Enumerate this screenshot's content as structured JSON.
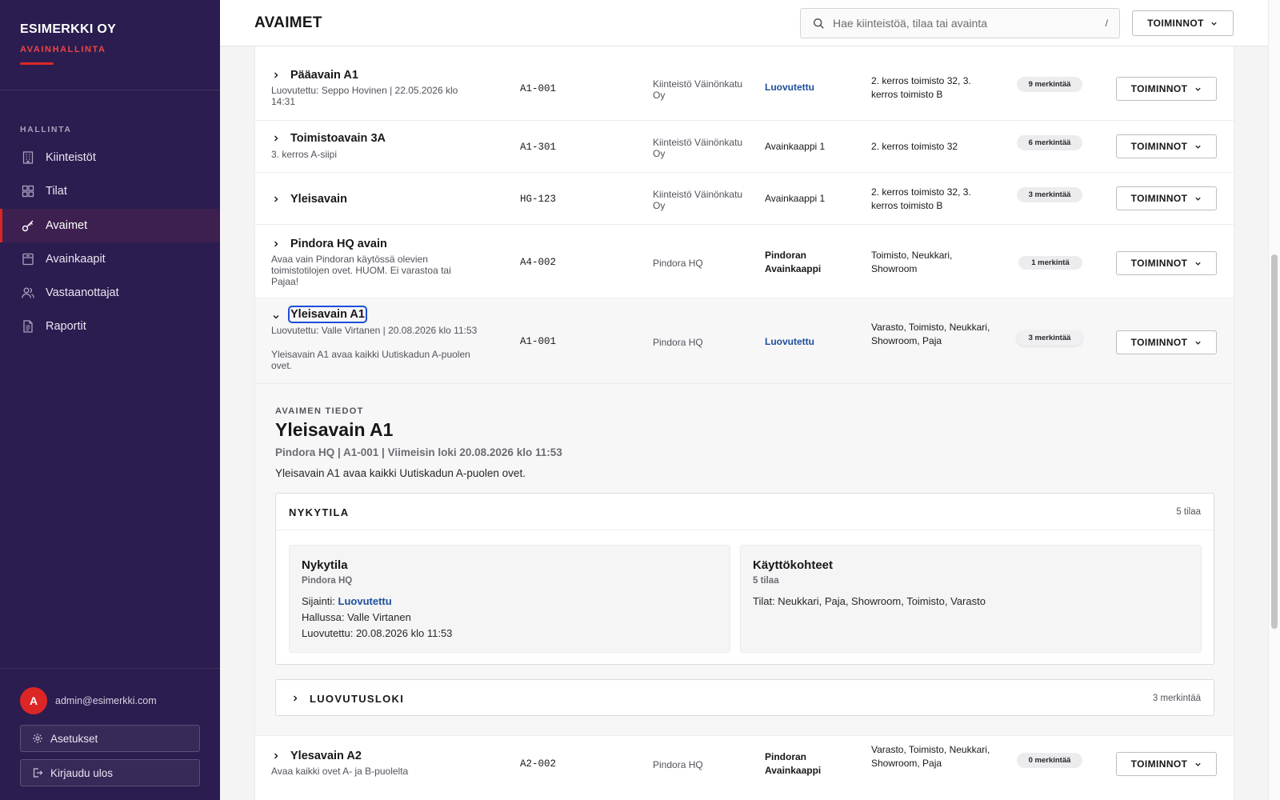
{
  "sidebar": {
    "brand": "ESIMERKKI OY",
    "subtitle": "AVAINHALLINTA",
    "section": "HALLINTA",
    "items": [
      {
        "label": "Kiinteistöt",
        "icon": "building-icon"
      },
      {
        "label": "Tilat",
        "icon": "grid-icon"
      },
      {
        "label": "Avaimet",
        "icon": "key-icon"
      },
      {
        "label": "Avainkaapit",
        "icon": "cabinet-icon"
      },
      {
        "label": "Vastaanottajat",
        "icon": "users-icon"
      },
      {
        "label": "Raportit",
        "icon": "report-icon"
      }
    ],
    "active_item": "Avaimet",
    "user_initial": "A",
    "user_email": "admin@esimerkki.com",
    "settings_label": "Asetukset",
    "logout_label": "Kirjaudu ulos"
  },
  "header": {
    "title": "AVAIMET",
    "search_placeholder": "Hae kiinteistöä, tilaa tai avainta",
    "search_shortcut": "/",
    "actions_label": "TOIMINNOT"
  },
  "keys": [
    {
      "name": "Pääavain A1",
      "sub": "Luovutettu: Seppo Hovinen | 22.05.2026 klo 14:31",
      "code": "A1-001",
      "property": "Kiinteistö Väinönkatu Oy",
      "location": "Luovutettu",
      "rooms": "2. kerros toimisto 32, 3. kerros toimisto B",
      "badge": "9 merkintää",
      "action": "TOIMINNOT"
    },
    {
      "name": "Toimistoavain 3A",
      "sub": "3. kerros A-siipi",
      "code": "A1-301",
      "property": "Kiinteistö Väinönkatu Oy",
      "location": "Avainkaappi 1",
      "rooms": "2. kerros toimisto 32",
      "badge": "6 merkintää",
      "action": "TOIMINNOT"
    },
    {
      "name": "Yleisavain",
      "sub": "",
      "code": "HG-123",
      "property": "Kiinteistö Väinönkatu Oy",
      "location": "Avainkaappi 1",
      "rooms": "2. kerros toimisto 32, 3. kerros toimisto B",
      "badge": "3 merkintää",
      "action": "TOIMINNOT"
    },
    {
      "name": "Pindora HQ avain",
      "sub": "Avaa vain Pindoran käytössä olevien toimistotilojen ovet. HUOM. Ei varastoa tai Pajaa!",
      "code": "A4-002",
      "property": "Pindora HQ",
      "location": "Pindoran Avainkaappi",
      "rooms": "Toimisto, Neukkari, Showroom",
      "badge": "1 merkintä",
      "action": "TOIMINNOT"
    },
    {
      "name": "Yleisavain A1",
      "sub": "Luovutettu: Valle Virtanen | 20.08.2026 klo 11:53",
      "sub2": "Yleisavain A1 avaa kaikki Uutiskadun A-puolen ovet.",
      "code": "A1-001",
      "property": "Pindora HQ",
      "location": "Luovutettu",
      "rooms": "Varasto, Toimisto, Neukkari, Showroom, Paja",
      "badge": "3 merkintää",
      "action": "TOIMINNOT"
    },
    {
      "name": "Ylesavain A2",
      "sub": "Avaa kaikki ovet A- ja B-puolelta",
      "code": "A2-002",
      "property": "Pindora HQ",
      "location": "Pindoran Avainkaappi",
      "rooms": "Varasto, Toimisto, Neukkari, Showroom, Paja",
      "badge": "0 merkintää",
      "action": "TOIMINNOT"
    }
  ],
  "details": {
    "label": "AVAIMEN TIEDOT",
    "title": "Yleisavain A1",
    "meta": "Pindora HQ | A1-001 | Viimeisin loki 20.08.2026 klo 11:53",
    "description": "Yleisavain A1 avaa kaikki Uutiskadun A-puolen ovet.",
    "current_section": {
      "title": "NYKYTILA",
      "count": "5 tilaa",
      "status_card": {
        "title": "Nykytila",
        "subtitle": "Pindora HQ",
        "location_label": "Sijainti: ",
        "location_value": "Luovutettu",
        "holder": "Hallussa: Valle Virtanen",
        "handed": "Luovutettu: 20.08.2026 klo 11:53"
      },
      "usage_card": {
        "title": "Käyttökohteet",
        "subtitle": "5 tilaa",
        "rooms": "Tilat: Neukkari, Paja, Showroom, Toimisto, Varasto"
      }
    },
    "log_section": {
      "title": "LUOVUTUSLOKI",
      "count": "3 merkintää"
    }
  },
  "colors": {
    "sidebar_bg": "#2b1d4f",
    "accent_red": "#dc2626",
    "status_blue": "#1e4e9b"
  }
}
